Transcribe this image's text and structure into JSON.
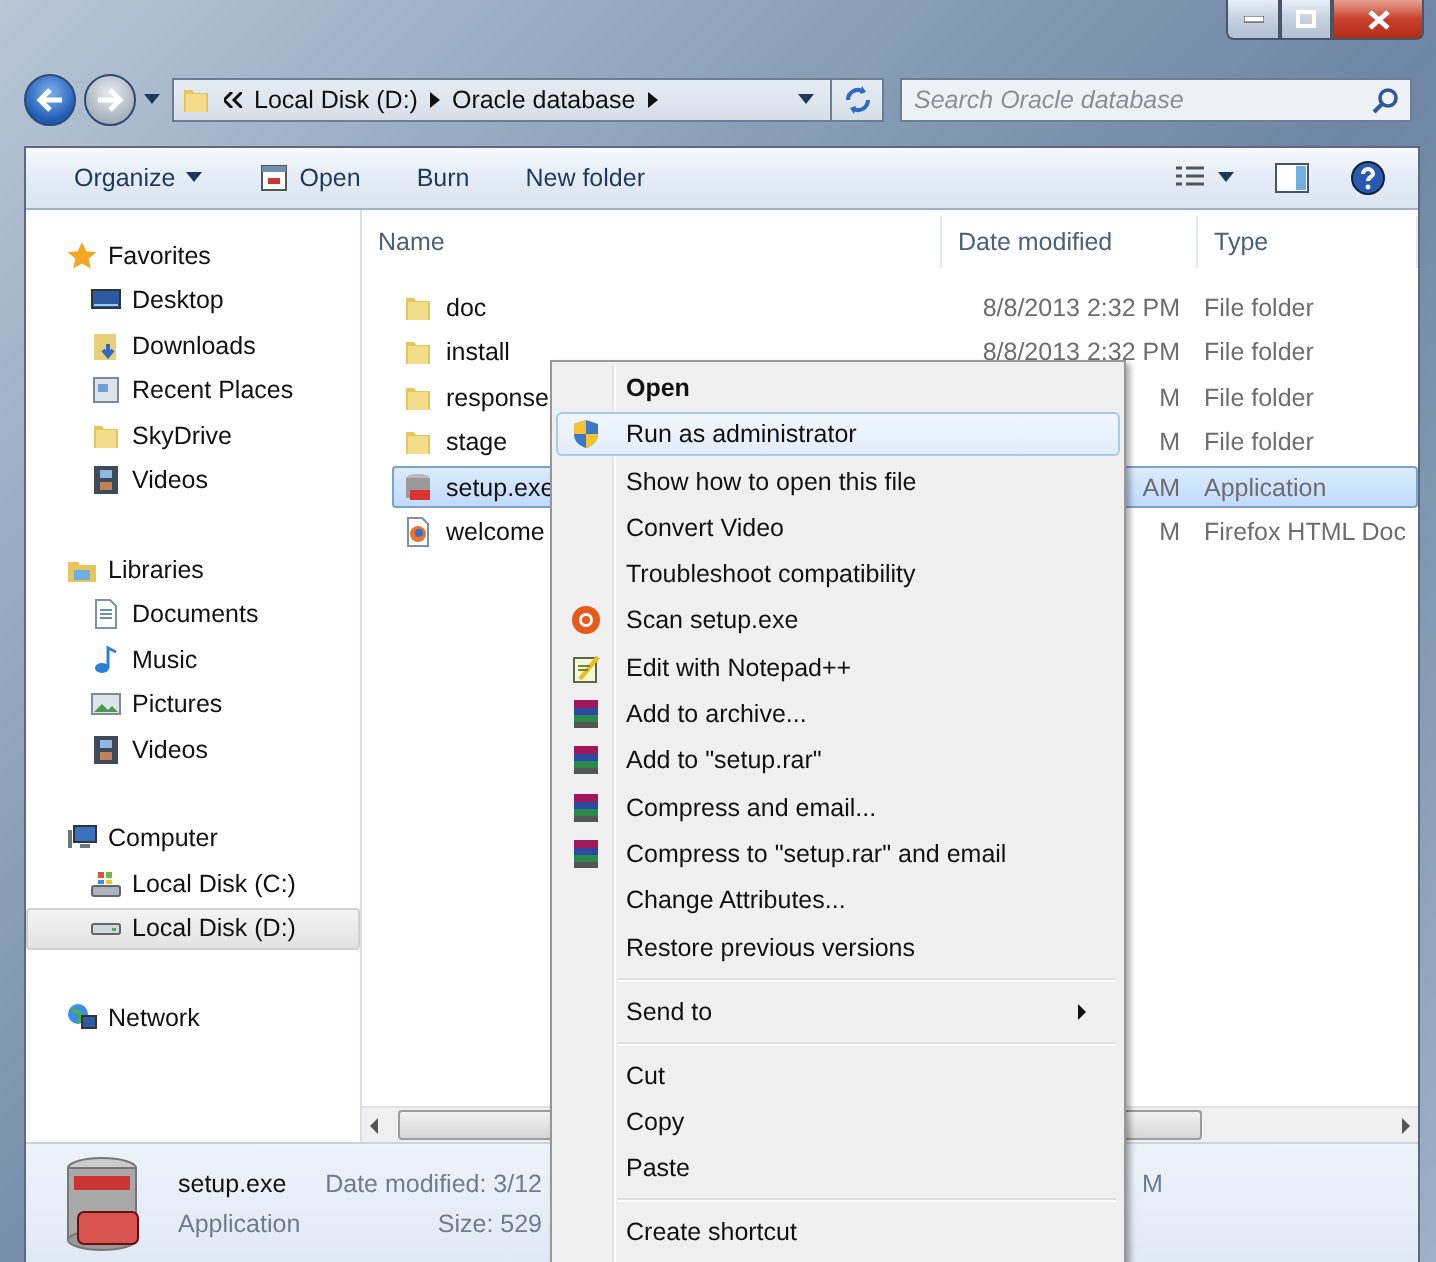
{
  "address": {
    "crumbs": [
      "Local Disk (D:)",
      "Oracle database"
    ]
  },
  "search": {
    "placeholder": "Search Oracle database"
  },
  "toolbar": {
    "items": [
      {
        "label": "Organize",
        "kind": "dropdown"
      },
      {
        "label": "Open",
        "kind": "open"
      },
      {
        "label": "Burn",
        "kind": "plain"
      },
      {
        "label": "New folder",
        "kind": "plain"
      }
    ]
  },
  "nav": [
    {
      "label": "Favorites",
      "children": [
        {
          "label": "Desktop",
          "selected": false
        },
        {
          "label": "Downloads",
          "selected": false
        },
        {
          "label": "Recent Places",
          "selected": false
        },
        {
          "label": "SkyDrive",
          "selected": false
        },
        {
          "label": "Videos",
          "selected": false
        }
      ]
    },
    {
      "label": "Libraries",
      "children": [
        {
          "label": "Documents",
          "selected": false
        },
        {
          "label": "Music",
          "selected": false
        },
        {
          "label": "Pictures",
          "selected": false
        },
        {
          "label": "Videos",
          "selected": false
        }
      ]
    },
    {
      "label": "Computer",
      "children": [
        {
          "label": "Local Disk (C:)",
          "selected": false
        },
        {
          "label": "Local Disk (D:)",
          "selected": true
        }
      ]
    },
    {
      "label": "Network"
    }
  ],
  "table": {
    "columns": [
      "Name",
      "Date modified",
      "Type"
    ],
    "rows": [
      {
        "kind": "folder",
        "name": "doc",
        "date": "8/8/2013 2:32 PM",
        "type": "File folder",
        "selected": false
      },
      {
        "kind": "folder",
        "name": "install",
        "date": "8/8/2013 2:32 PM",
        "type": "File folder",
        "selected": false
      },
      {
        "kind": "folder",
        "name": "response",
        "date": "M",
        "type": "File folder",
        "selected": false
      },
      {
        "kind": "folder",
        "name": "stage",
        "date": "M",
        "type": "File folder",
        "selected": false
      },
      {
        "kind": "application",
        "name": "setup.exe",
        "date": "AM",
        "type": "Application",
        "selected": true
      },
      {
        "kind": "document",
        "name": "welcome",
        "date": "M",
        "type": "Firefox HTML Doc",
        "selected": false
      }
    ]
  },
  "status_bar": {
    "name": "setup.exe",
    "type": "Application",
    "date_label": "Date modified: 3/12",
    "size_label": "Size: 529",
    "date_tail": "M"
  },
  "context_menu": [
    {
      "kind": "default",
      "label": "Open",
      "selected": false
    },
    {
      "kind": "item",
      "label": "Run as administrator",
      "selected": true
    },
    {
      "kind": "item",
      "label": "Show how to open this file",
      "selected": false
    },
    {
      "kind": "item",
      "label": "Convert Video",
      "selected": false
    },
    {
      "kind": "item",
      "label": "Troubleshoot compatibility",
      "selected": false
    },
    {
      "kind": "item",
      "label": "Scan setup.exe",
      "selected": false
    },
    {
      "kind": "item",
      "label": "Edit with Notepad++",
      "selected": false
    },
    {
      "kind": "item",
      "label": "Add to archive...",
      "selected": false
    },
    {
      "kind": "item",
      "label": "Add to \"setup.rar\"",
      "selected": false
    },
    {
      "kind": "item",
      "label": "Compress and email...",
      "selected": false
    },
    {
      "kind": "item",
      "label": "Compress to \"setup.rar\" and email",
      "selected": false
    },
    {
      "kind": "item",
      "label": "Change Attributes...",
      "selected": false
    },
    {
      "kind": "item",
      "label": "Restore previous versions",
      "selected": false
    },
    {
      "kind": "separator"
    },
    {
      "kind": "submenu",
      "label": "Send to",
      "selected": false
    },
    {
      "kind": "separator"
    },
    {
      "kind": "item",
      "label": "Cut",
      "selected": false
    },
    {
      "kind": "item",
      "label": "Copy",
      "selected": false
    },
    {
      "kind": "item",
      "label": "Paste",
      "selected": false
    },
    {
      "kind": "separator"
    },
    {
      "kind": "item",
      "label": "Create shortcut",
      "selected": false
    }
  ]
}
